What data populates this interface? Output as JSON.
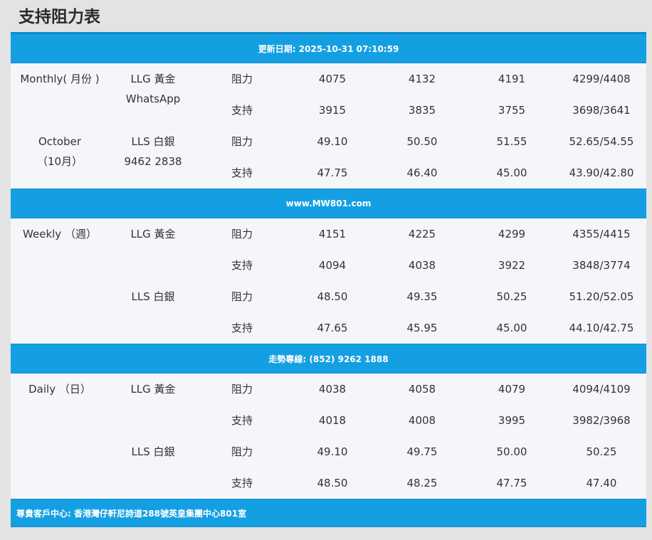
{
  "title": "支持阻力表",
  "banners": {
    "update": "更新日期: 2025-10-31 07:10:59",
    "website": "www.MW801.com",
    "hotline": "走勢專線: (852) 9262 1888",
    "address": "尊貴客戶中心: 香港灣仔軒尼詩道288號英皇集團中心801室"
  },
  "labels": {
    "resistance": "阻力",
    "support": "支持"
  },
  "sections": [
    {
      "period": "Monthly( 月份 )",
      "period_sub": "October",
      "period_sub2": "（10月）",
      "gold_label": "LLG 黃金",
      "gold_sub": "WhatsApp",
      "silver_label": "LLS 白銀",
      "silver_sub": "9462 2838",
      "gold_res": [
        "4075",
        "4132",
        "4191",
        "4299/4408"
      ],
      "gold_sup": [
        "3915",
        "3835",
        "3755",
        "3698/3641"
      ],
      "silver_res": [
        "49.10",
        "50.50",
        "51.55",
        "52.65/54.55"
      ],
      "silver_sup": [
        "47.75",
        "46.40",
        "45.00",
        "43.90/42.80"
      ]
    },
    {
      "period": "Weekly （週）",
      "gold_label": "LLG 黃金",
      "silver_label": "LLS 白銀",
      "gold_res": [
        "4151",
        "4225",
        "4299",
        "4355/4415"
      ],
      "gold_sup": [
        "4094",
        "4038",
        "3922",
        "3848/3774"
      ],
      "silver_res": [
        "48.50",
        "49.35",
        "50.25",
        "51.20/52.05"
      ],
      "silver_sup": [
        "47.65",
        "45.95",
        "45.00",
        "44.10/42.75"
      ]
    },
    {
      "period": "Daily （日）",
      "gold_label": "LLG 黃金",
      "silver_label": "LLS 白銀",
      "gold_res": [
        "4038",
        "4058",
        "4079",
        "4094/4109"
      ],
      "gold_sup": [
        "4018",
        "4008",
        "3995",
        "3982/3968"
      ],
      "silver_res": [
        "49.10",
        "49.75",
        "50.00",
        "50.25"
      ],
      "silver_sup": [
        "48.50",
        "48.25",
        "47.75",
        "47.40"
      ]
    }
  ],
  "colors": {
    "banner": "#159fe3",
    "banner_border": "#0d8bc9",
    "panel": "#f5f6fa",
    "page_bg": "#e3e3e3"
  }
}
